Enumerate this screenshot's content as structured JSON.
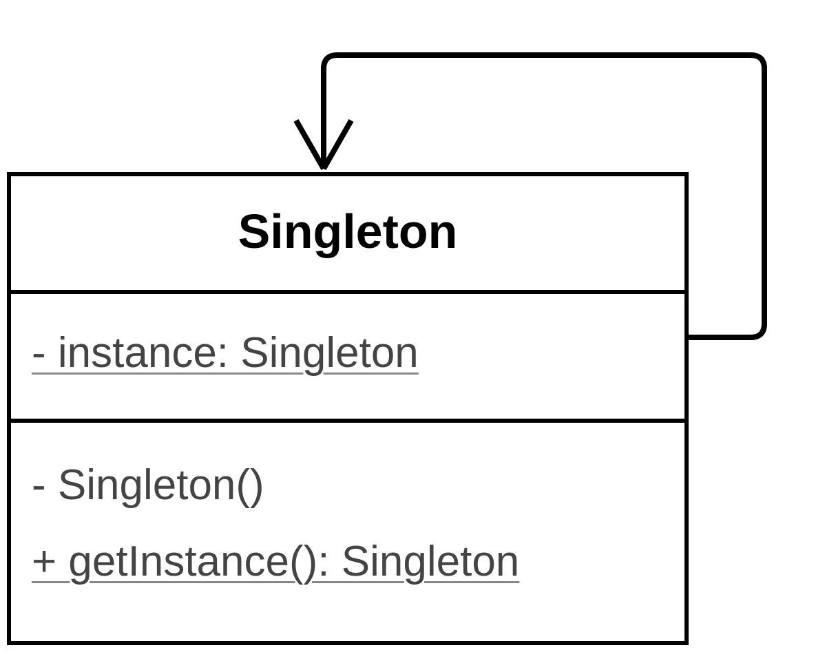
{
  "uml_class": {
    "name": "Singleton",
    "attributes": [
      {
        "text": "- instance: Singleton",
        "static": true
      }
    ],
    "methods": [
      {
        "text": "- Singleton()",
        "static": false
      },
      {
        "text": "+ getInstance(): Singleton",
        "static": true
      }
    ]
  },
  "associations": [
    {
      "from": "Singleton",
      "to": "Singleton",
      "type": "self-reference",
      "navigable_to": true
    }
  ]
}
